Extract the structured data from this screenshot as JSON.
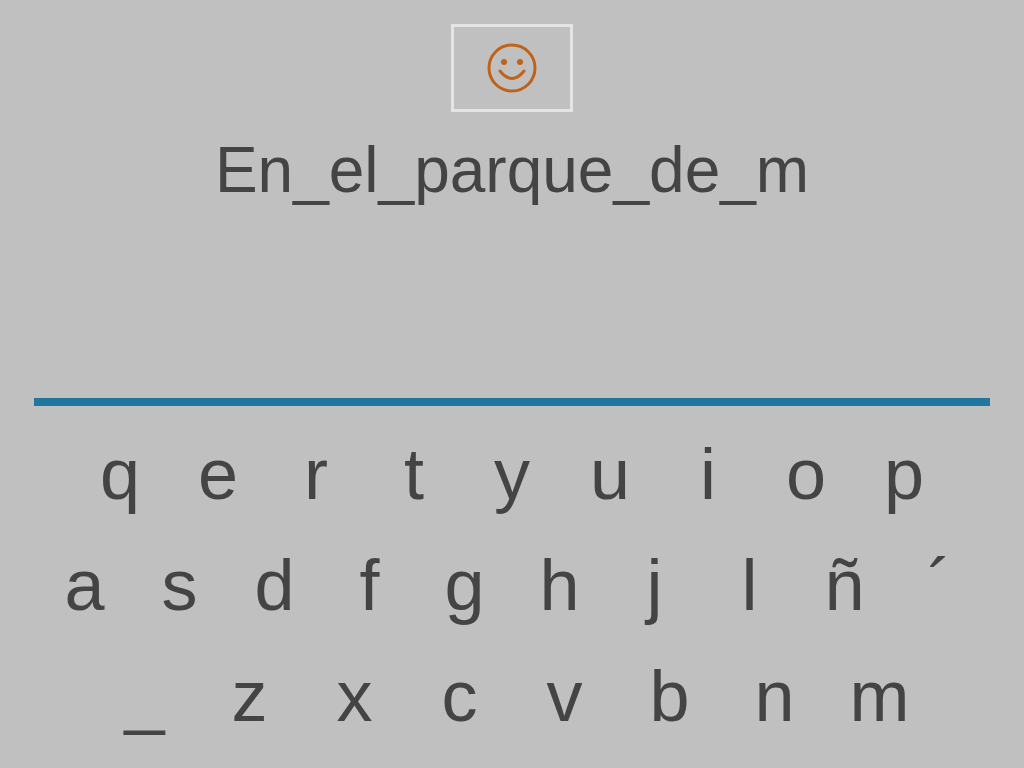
{
  "phrase": "En_el_parque_de_m",
  "keyboard": {
    "rows": [
      [
        "q",
        "e",
        "r",
        "t",
        "y",
        "u",
        "i",
        "o",
        "p"
      ],
      [
        "a",
        "s",
        "d",
        "f",
        "g",
        "h",
        "j",
        "l",
        "ñ",
        "´"
      ],
      [
        "_",
        "z",
        "x",
        "c",
        "v",
        "b",
        "n",
        "m"
      ]
    ]
  }
}
